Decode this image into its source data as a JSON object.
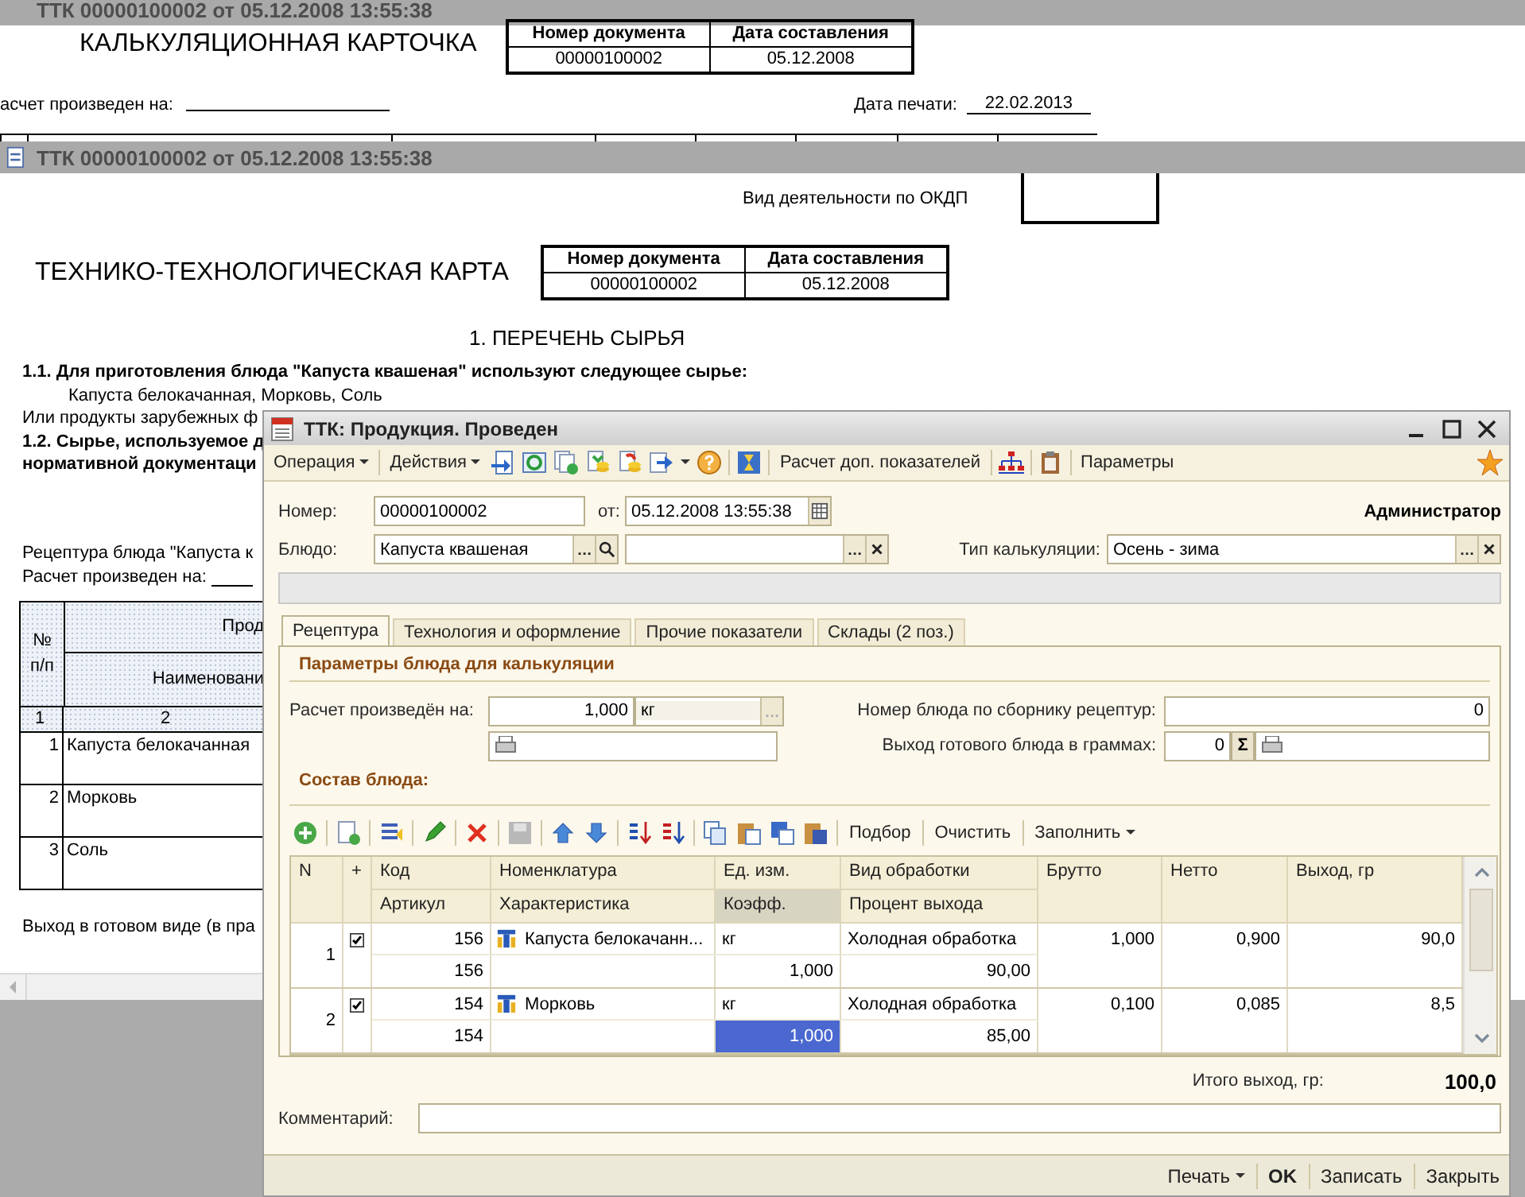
{
  "back_window": {
    "title": "ТТК 00000100002 от 05.12.2008 13:55:38",
    "heading": "КАЛЬКУЛЯЦИОННАЯ КАРТОЧКА",
    "doc_table": {
      "headers": [
        "Номер документа",
        "Дата составления"
      ],
      "values": [
        "00000100002",
        "05.12.2008"
      ]
    },
    "calc_label": "асчет произведен на:",
    "print_date_label": "Дата печати:",
    "print_date": "22.02.2013"
  },
  "document_window": {
    "title": "ТТК 00000100002 от 05.12.2008 13:55:38",
    "okdp_label": "Вид деятельности по ОКДП",
    "heading": "ТЕХНИКО-ТЕХНОЛОГИЧЕСКАЯ КАРТА",
    "doc_table": {
      "headers": [
        "Номер документа",
        "Дата составления"
      ],
      "values": [
        "00000100002",
        "05.12.2008"
      ]
    },
    "section_title": "1. ПЕРЕЧЕНЬ СЫРЬЯ",
    "paragraphs": [
      {
        "kind": "bold",
        "text": "1.1. Для приготовления блюда \"Капуста квашеная\" используют следующее сырье:"
      },
      {
        "kind": "indent",
        "text": "Капуста белокачанная, Морковь, Соль"
      },
      {
        "kind": "plain",
        "text": "Или продукты зарубежных ф"
      },
      {
        "kind": "bold",
        "text": "1.2. Сырье, используемое д"
      },
      {
        "kind": "bold",
        "text": "нормативной документаци"
      }
    ],
    "recipe_title": "Рецептура блюда \"Капуста к",
    "calc_label": "Расчет произведен на:",
    "table": {
      "no_header": [
        "№",
        "п/п"
      ],
      "group_header": "Прод",
      "name_header": "Наименовани",
      "index_row": [
        "1",
        "2"
      ],
      "rows": [
        {
          "n": "1",
          "name": "Капуста белокачанная"
        },
        {
          "n": "2",
          "name": "Морковь"
        },
        {
          "n": "3",
          "name": "Соль"
        }
      ]
    },
    "footer": "Выход в готовом виде (в пра"
  },
  "dialog": {
    "title": "ТТК: Продукция. Проведен",
    "toolbar": {
      "operation": "Операция",
      "actions": "Действия",
      "calc": "Расчет доп. показателей",
      "params": "Параметры"
    },
    "number_label": "Номер:",
    "number": "00000100002",
    "date_label": "от:",
    "date": "05.12.2008 13:55:38",
    "user": "Администратор",
    "dish_label": "Блюдо:",
    "dish": "Капуста квашеная",
    "calc_type_label": "Тип калькуляции:",
    "calc_type": "Осень - зима",
    "tabs": [
      {
        "label": "Рецептура",
        "selected": true
      },
      {
        "label": "Технология и оформление",
        "selected": false
      },
      {
        "label": "Прочие показатели",
        "selected": false
      },
      {
        "label": "Склады (2 поз.)",
        "selected": false
      }
    ],
    "params_title": "Параметры блюда для калькуляции",
    "calc_on_label": "Расчет произведён на:",
    "calc_on": "1,000",
    "calc_unit": "кг",
    "recipe_no_label": "Номер блюда по сборнику рецептур:",
    "recipe_no": "0",
    "output_label": "Выход готового блюда в граммах:",
    "output": "0",
    "sum_button": "Σ",
    "composition_title": "Состав блюда:",
    "grid_toolbar": [
      "Подбор",
      "Очистить",
      "Заполнить"
    ],
    "columns": [
      {
        "top": "N",
        "active": false
      },
      {
        "top": "+",
        "active": false
      },
      {
        "top": "Код",
        "bottom": "Артикул",
        "active": false
      },
      {
        "top": "Номенклатура",
        "bottom": "Характеристика",
        "active": false
      },
      {
        "top": "Ед. изм.",
        "bottom": "Коэфф.",
        "active": true
      },
      {
        "top": "Вид обработки",
        "bottom": "Процент выхода",
        "active": false
      },
      {
        "top": "Брутто",
        "active": false
      },
      {
        "top": "Нетто",
        "active": false
      },
      {
        "top": "Выход, гр",
        "active": false
      }
    ],
    "rows": [
      {
        "n": "1",
        "included": true,
        "code": "156",
        "article": "156",
        "name": "Капуста белокачанн...",
        "unit": "кг",
        "coef": "1,000",
        "coef_selected": false,
        "processing": "Холодная обработка",
        "percent": "90,00",
        "brutto": "1,000",
        "netto": "0,900",
        "output": "90,0"
      },
      {
        "n": "2",
        "included": true,
        "code": "154",
        "article": "154",
        "name": "Морковь",
        "unit": "кг",
        "coef": "1,000",
        "coef_selected": true,
        "processing": "Холодная обработка",
        "percent": "85,00",
        "brutto": "0,100",
        "netto": "0,085",
        "output": "8,5"
      }
    ],
    "total_label": "Итого выход, гр:",
    "total": "100,0",
    "comment_label": "Комментарий:",
    "buttons": [
      {
        "label": "Печать",
        "kind": "menu"
      },
      {
        "label": "OK",
        "kind": "default"
      },
      {
        "label": "Записать",
        "kind": "plain"
      },
      {
        "label": "Закрыть",
        "kind": "plain"
      }
    ]
  }
}
